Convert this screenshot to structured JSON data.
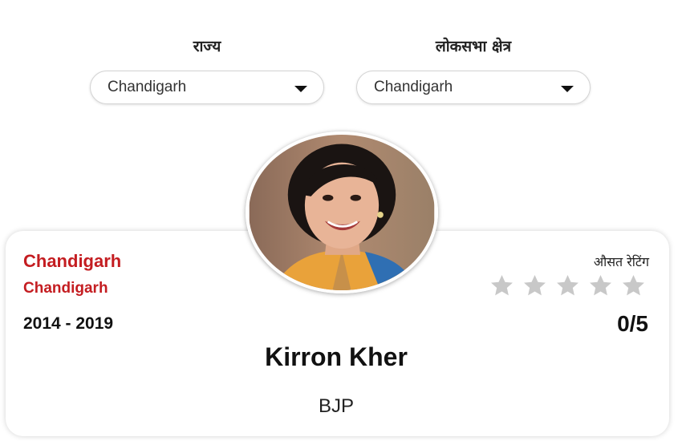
{
  "filters": {
    "state": {
      "label": "राज्य",
      "value": "Chandigarh"
    },
    "constituency": {
      "label": "लोकसभा क्षेत्र",
      "value": "Chandigarh"
    }
  },
  "mp_card": {
    "state": "Chandigarh",
    "constituency": "Chandigarh",
    "term": "2014 - 2019",
    "name": "Kirron Kher",
    "party": "BJP",
    "rating": {
      "label": "औसत रेटिंग",
      "value_text": "0/5",
      "stars_total": 5,
      "stars_filled": 0
    },
    "photo": {
      "icon": "portrait-photo"
    }
  },
  "colors": {
    "accent_red": "#c41d21",
    "star_empty": "#c8c8c8",
    "star_filled": "#f2b01e"
  }
}
